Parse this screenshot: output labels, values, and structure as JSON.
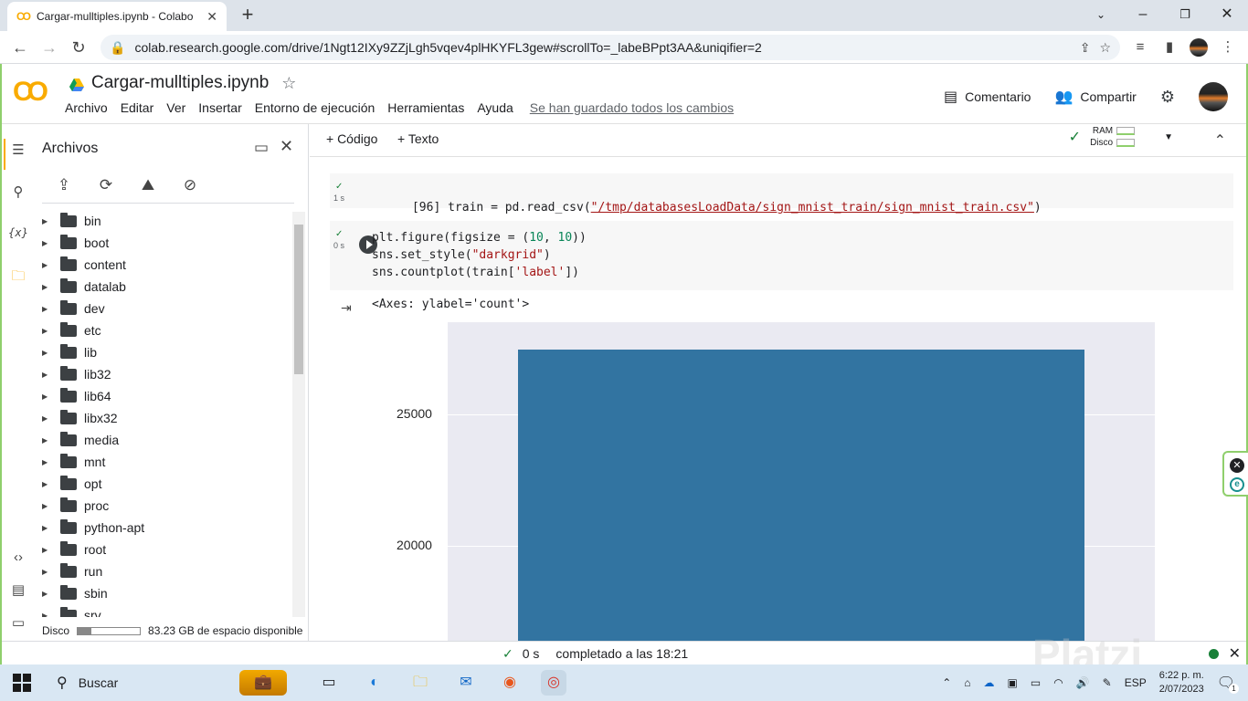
{
  "browser": {
    "tab_title": "Cargar-mulltiples.ipynb - Colabo",
    "url": "colab.research.google.com/drive/1Ngt12IXy9ZZjLgh5vqev4plHKYFL3gew#scrollTo=_labeBPpt3AA&uniqifier=2"
  },
  "colab": {
    "logo": "CO",
    "notebook_title": "Cargar-mulltiples.ipynb",
    "menu": [
      "Archivo",
      "Editar",
      "Ver",
      "Insertar",
      "Entorno de ejecución",
      "Herramientas",
      "Ayuda"
    ],
    "saved_status": "Se han guardado todos los cambios",
    "comment_label": "Comentario",
    "share_label": "Compartir"
  },
  "rail": {
    "variables_label": "{x}"
  },
  "files_panel": {
    "title": "Archivos",
    "folders": [
      "bin",
      "boot",
      "content",
      "datalab",
      "dev",
      "etc",
      "lib",
      "lib32",
      "lib64",
      "libx32",
      "media",
      "mnt",
      "opt",
      "proc",
      "python-apt",
      "root",
      "run",
      "sbin",
      "srv"
    ],
    "disk_label": "Disco",
    "disk_used_fraction": 0.22,
    "disk_free": "83.23 GB de espacio disponible"
  },
  "notebook": {
    "add_code": "+ Código",
    "add_text": "+ Texto",
    "ram_label": "RAM",
    "disk_label": "Disco",
    "cell1": {
      "exec_time": "1 s",
      "prompt": "[96]",
      "code_prefix": "train = pd.read_csv(",
      "code_string": "\"/tmp/databasesLoadData/sign_mnist_train/sign_mnist_train.csv\"",
      "code_suffix": ")"
    },
    "cell2": {
      "exec_time": "0 s",
      "line1_a": "plt.figure(figsize = (",
      "line1_num1": "10",
      "line1_b": ", ",
      "line1_num2": "10",
      "line1_c": "))",
      "line2_a": "sns.set_style(",
      "line2_str": "\"darkgrid\"",
      "line2_b": ")",
      "line3_a": "sns.countplot(train[",
      "line3_str": "'label'",
      "line3_b": "])"
    },
    "output_text": "<Axes: ylabel='count'>"
  },
  "chart_data": {
    "type": "bar",
    "categories": [
      ""
    ],
    "values": [
      27455
    ],
    "ylabel": "",
    "yticks": [
      20000,
      25000
    ],
    "ylim": [
      16000,
      28500
    ],
    "grid": true,
    "bar_color": "#3274a1",
    "background": "#eaeaf2"
  },
  "statusbar": {
    "time": "0 s",
    "message": "completado a las 18:21"
  },
  "watermark": "Platzi",
  "taskbar": {
    "search_label": "Buscar",
    "language": "ESP",
    "time": "6:22 p. m.",
    "date": "2/07/2023",
    "notif_count": "1"
  },
  "colors": {
    "accent": "#f9ab00",
    "frame": "#8fcf6c",
    "bar": "#3274a1"
  }
}
